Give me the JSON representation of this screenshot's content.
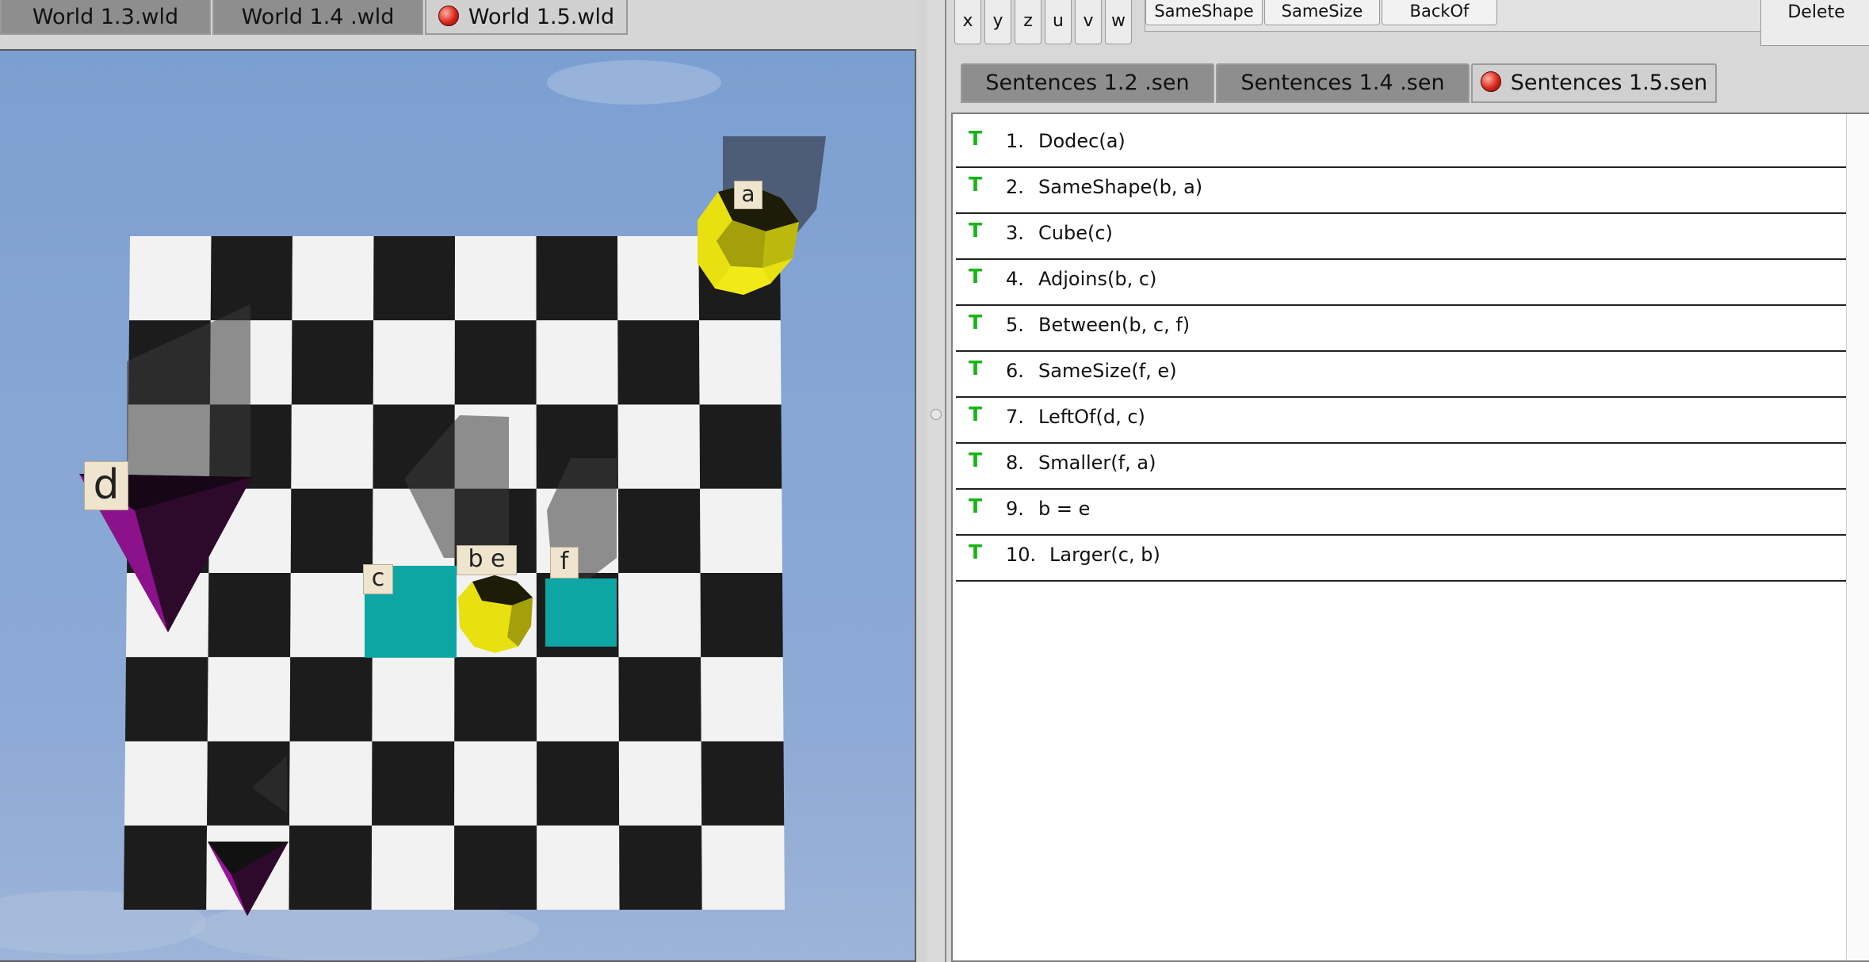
{
  "world_tabs": [
    {
      "label": "World 1.3.wld",
      "active": false
    },
    {
      "label": "World 1.4 .wld",
      "active": false
    },
    {
      "label": "World 1.5.wld",
      "active": true
    }
  ],
  "world_objects": {
    "a": "a",
    "b_e": "b e",
    "c": "c",
    "d": "d",
    "f": "f"
  },
  "variable_buttons": [
    "x",
    "y",
    "z",
    "u",
    "v",
    "w"
  ],
  "predicate_buttons": [
    "SameShape",
    "SameSize",
    "BackOf"
  ],
  "delete_label": "Delete",
  "sentence_tabs": [
    {
      "label": "Sentences 1.2 .sen",
      "active": false
    },
    {
      "label": "Sentences 1.4 .sen",
      "active": false
    },
    {
      "label": "Sentences 1.5.sen",
      "active": true
    }
  ],
  "sentences": [
    {
      "truth": "T",
      "num": "1.",
      "text": "Dodec(a)"
    },
    {
      "truth": "T",
      "num": "2.",
      "text": "SameShape(b, a)"
    },
    {
      "truth": "T",
      "num": "3.",
      "text": "Cube(c)"
    },
    {
      "truth": "T",
      "num": "4.",
      "text": "Adjoins(b, c)"
    },
    {
      "truth": "T",
      "num": "5.",
      "text": "Between(b, c, f)"
    },
    {
      "truth": "T",
      "num": "6.",
      "text": "SameSize(f, e)"
    },
    {
      "truth": "T",
      "num": "7.",
      "text": "LeftOf(d, c)"
    },
    {
      "truth": "T",
      "num": "8.",
      "text": "Smaller(f, a)"
    },
    {
      "truth": "T",
      "num": "9.",
      "text": "b = e"
    },
    {
      "truth": "T",
      "num": "10.",
      "text": "Larger(c, b)"
    }
  ],
  "colors": {
    "truth_true": "#18b418",
    "cube": "#0ea5a5",
    "dodec": "#e8e010",
    "tetra": "#3a0d36"
  }
}
